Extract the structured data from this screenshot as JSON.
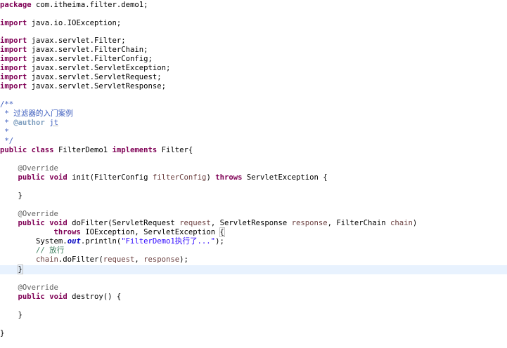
{
  "colors": {
    "keyword": "#7f0055",
    "string": "#2a00ff",
    "annotation": "#646464",
    "javadoc": "#3f5fbf",
    "javadoc_tag": "#7f9fbf",
    "comment": "#3f7f5f",
    "parameter": "#6a3e3e",
    "static_field": "#0000c0",
    "current_line_highlight": "#e8f2fe"
  },
  "code": {
    "l1_kw": "package",
    "l1_rest": " com.itheima.filter.demo1;",
    "l3_kw": "import",
    "l3_rest": " java.io.IOException;",
    "l5_kw": "import",
    "l5_rest": " javax.servlet.Filter;",
    "l6_kw": "import",
    "l6_rest": " javax.servlet.FilterChain;",
    "l7_kw": "import",
    "l7_rest": " javax.servlet.FilterConfig;",
    "l8_kw": "import",
    "l8_rest": " javax.servlet.ServletException;",
    "l9_kw": "import",
    "l9_rest": " javax.servlet.ServletRequest;",
    "l10_kw": "import",
    "l10_rest": " javax.servlet.ServletResponse;",
    "doc_open": "/**",
    "doc_line1": " * 过滤器的入门案例",
    "doc_line2_prefix": " * ",
    "doc_author_tag": "@author",
    "doc_author_space": " ",
    "doc_author_name": "jt",
    "doc_line3": " *",
    "doc_close": " */",
    "class_kw1": "public",
    "class_sp1": " ",
    "class_kw2": "class",
    "class_name": " FilterDemo1 ",
    "class_kw3": "implements",
    "class_rest": " Filter{",
    "ann_override_1": "@Override",
    "init_kw1": "public",
    "init_sp1": " ",
    "init_kw2": "void",
    "init_mid": " init(FilterConfig ",
    "init_param": "filterConfig",
    "init_close": ") ",
    "init_kw3": "throws",
    "init_rest": " ServletException {",
    "brace_close_1": "}",
    "ann_override_2": "@Override",
    "do_kw1": "public",
    "do_sp1": " ",
    "do_kw2": "void",
    "do_mid1": " doFilter(ServletRequest ",
    "do_param1": "request",
    "do_mid2": ", ServletResponse ",
    "do_param2": "response",
    "do_mid3": ", FilterChain ",
    "do_param3": "chain",
    "do_close": ")",
    "do_throws_kw": "throws",
    "do_throws_rest": " IOException, ServletException ",
    "do_throws_brace": "{",
    "sysout_pre": "System.",
    "sysout_field": "out",
    "sysout_mid": ".println(",
    "sysout_str": "\"FilterDemo1执行了...\"",
    "sysout_end": ");",
    "cmt_release": "// 放行",
    "chain_param": "chain",
    "chain_mid": ".doFilter(",
    "chain_p1": "request",
    "chain_comma": ", ",
    "chain_p2": "response",
    "chain_end": ");",
    "brace_close_2": "}",
    "ann_override_3": "@Override",
    "destroy_kw1": "public",
    "destroy_sp1": " ",
    "destroy_kw2": "void",
    "destroy_rest": " destroy() {",
    "brace_close_3": "}",
    "brace_close_class": "}"
  }
}
